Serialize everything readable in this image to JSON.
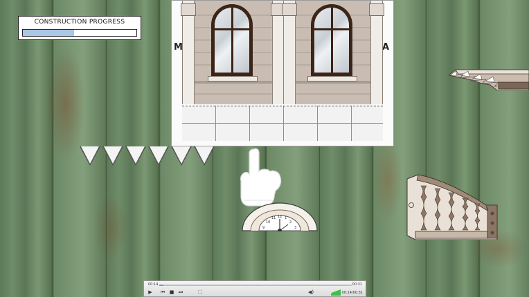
{
  "hud": {
    "progress_label": "CONSTRUCTION PROGRESS",
    "progress_value": 0.45
  },
  "sheet": {
    "label_left": "M",
    "label_right": "A"
  },
  "player": {
    "time_current": "00:14",
    "time_end": "00:31",
    "duration": "00:14/00:31",
    "seek_fraction": 0.02,
    "buttons": {
      "play": "▶",
      "prev": "⏮",
      "stop": "■",
      "next": "⏭",
      "fullscreen": "⛶",
      "volume": "◀)"
    }
  },
  "colors": {
    "progress_fill": "#a9c7e6",
    "window_frame": "#3c2416",
    "wood": "#6a8763"
  }
}
